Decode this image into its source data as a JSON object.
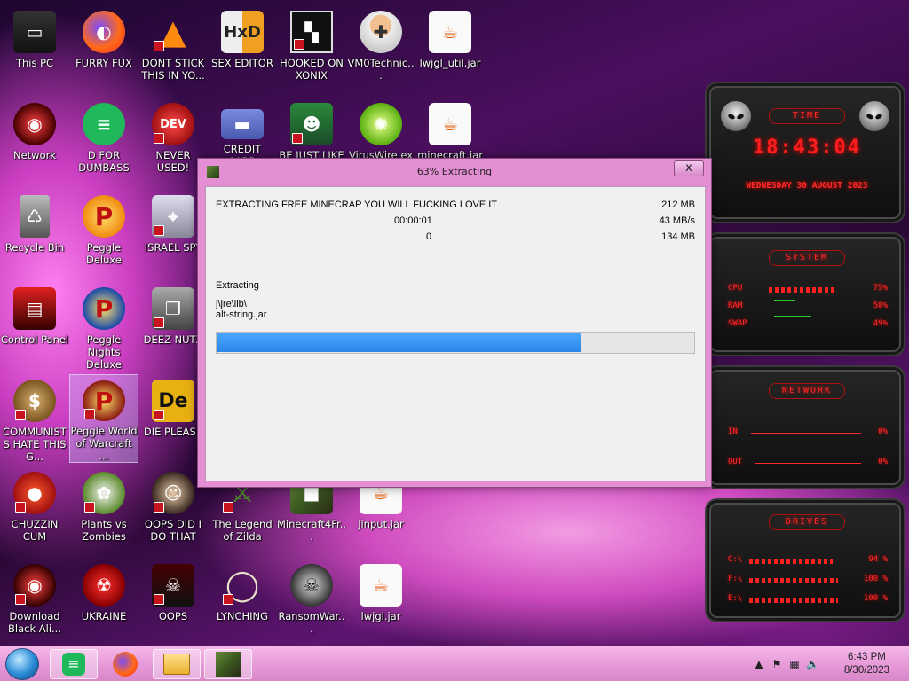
{
  "desktop": {
    "icons": [
      {
        "label": "This PC",
        "icon": "computer-icon"
      },
      {
        "label": "FURRY FUX",
        "icon": "firefox-icon"
      },
      {
        "label": "DONT STICK THIS IN YO...",
        "icon": "vlc-cone-icon"
      },
      {
        "label": "SEX EDITOR",
        "icon": "hxd-editor-icon"
      },
      {
        "label": "HOOKED ON XONIX",
        "icon": "xonix-game-icon"
      },
      {
        "label": "VM0Technic...",
        "icon": "doctor-avatar-icon"
      },
      {
        "label": "lwjgl_util.jar",
        "icon": "java-icon"
      },
      {
        "label": "Network",
        "icon": "alienware-network-icon"
      },
      {
        "label": "D FOR DUMBASS",
        "icon": "green-chat-icon"
      },
      {
        "label": "NEVER USED!",
        "icon": "devcpp-icon"
      },
      {
        "label": "CREDIT CARD",
        "icon": "credit-card-icon"
      },
      {
        "label": "BE JUST LIKE",
        "icon": "santa-elf-icon"
      },
      {
        "label": "VirusWire.exe",
        "icon": "lime-icon"
      },
      {
        "label": "minecraft.jar",
        "icon": "java-icon"
      },
      {
        "label": "Recycle Bin",
        "icon": "recycle-bin-icon"
      },
      {
        "label": "Peggle Deluxe",
        "icon": "peggle-icon"
      },
      {
        "label": "ISRAEL SPY",
        "icon": "spy-camera-icon"
      },
      {
        "label": "Control Panel",
        "icon": "control-panel-icon"
      },
      {
        "label": "Peggle Nights Deluxe",
        "icon": "peggle-nights-icon"
      },
      {
        "label": "DEEZ NUTZ",
        "icon": "stacked-windows-icon"
      },
      {
        "label": "COMMUNISTS HATE THIS G...",
        "icon": "money-bag-icon"
      },
      {
        "label": "Peggle World of Warcraft ...",
        "icon": "peggle-wow-icon"
      },
      {
        "label": "DIE PLEASE",
        "icon": "de-icon"
      },
      {
        "label": "CHUZZIN CUM",
        "icon": "chuzzle-icon"
      },
      {
        "label": "Plants vs Zombies",
        "icon": "plant-icon"
      },
      {
        "label": "OOPS DID I DO THAT",
        "icon": "portrait-icon"
      },
      {
        "label": "The Legend of Zilda",
        "icon": "zelda-icon"
      },
      {
        "label": "Minecraft4Fr...",
        "icon": "minecraft-block-icon"
      },
      {
        "label": "jinput.jar",
        "icon": "java-icon"
      },
      {
        "label": "Download Black Ali...",
        "icon": "alienware-icon"
      },
      {
        "label": "UKRAINE",
        "icon": "radiation-icon"
      },
      {
        "label": "OOPS",
        "icon": "skull-frame-icon"
      },
      {
        "label": "LYNCHING",
        "icon": "noose-icon"
      },
      {
        "label": "RansomWar...",
        "icon": "skull-ring-icon"
      },
      {
        "label": "lwjgl.jar",
        "icon": "java-icon"
      }
    ]
  },
  "widget": {
    "time_title": "TIME",
    "clock": "18:43:04",
    "date": "WEDNESDAY 30 AUGUST 2023",
    "system_title": "SYSTEM",
    "cpu_label": "CPU",
    "cpu_value": "75%",
    "ram_label": "RAM",
    "ram_value": "58%",
    "swap_label": "SWAP",
    "swap_value": "49%",
    "network_title": "NETWORK",
    "in_label": "IN",
    "in_value": "0%",
    "out_label": "OUT",
    "out_value": "0%",
    "drives_title": "DRIVES",
    "drive_c_label": "C:\\",
    "drive_c_value": "94 %",
    "drive_f_label": "F:\\",
    "drive_f_value": "100 %",
    "drive_e_label": "E:\\",
    "drive_e_value": "100 %",
    "levels": {
      "cpu": 0.75,
      "ram": 0.58,
      "swap": 0.49,
      "c": 0.94,
      "f": 1.0,
      "e": 1.0
    }
  },
  "dialog": {
    "title": "63% Extracting",
    "close_label": "x",
    "headline": "EXTRACTING FREE MINECRAP YOU WILL FUCKING LOVE IT",
    "size_total": "212 MB",
    "elapsed": "00:00:01",
    "speed": "43 MB/s",
    "remaining": "0",
    "processed": "134 MB",
    "status": "Extracting",
    "path_dir": "j\\jre\\lib\\",
    "path_file": "alt-string.jar",
    "progress": 0.76
  },
  "taskbar": {
    "time": "6:43 PM",
    "date": "8/30/2023",
    "buttons": [
      {
        "icon": "green-chat-icon"
      },
      {
        "icon": "firefox-icon"
      },
      {
        "icon": "file-explorer-icon"
      },
      {
        "icon": "minecraft-block-icon"
      }
    ]
  },
  "colors": {
    "accent": "#2a86e6",
    "window_frame": "#e48ed3",
    "widget_red": "#ff1e1e"
  }
}
